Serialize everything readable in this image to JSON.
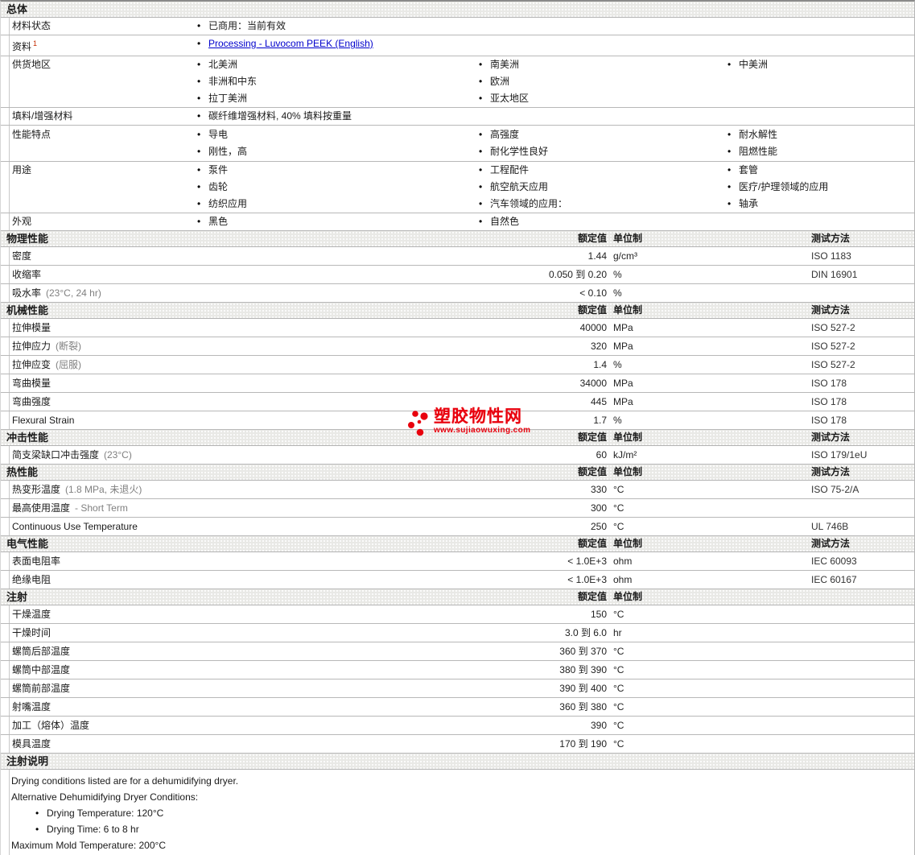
{
  "colors": {
    "accent_red": "#e8000d",
    "link_blue": "#0000cc",
    "header_bg": "#e9e9e6",
    "row_border": "#b8b8b8"
  },
  "watermark": {
    "brand": "塑胶物性网",
    "url": "www.sujiaowuxing.com"
  },
  "general": {
    "title": "总体",
    "rows": [
      {
        "label": "材料状态",
        "cols": [
          [
            "已商用：当前有效"
          ],
          [],
          []
        ]
      },
      {
        "label": "资料",
        "sup": "1",
        "link": true,
        "cols": [
          [
            "Processing - Luvocom PEEK (English)"
          ],
          [],
          []
        ]
      },
      {
        "label": "供货地区",
        "cols": [
          [
            "北美洲",
            "非洲和中东",
            "拉丁美洲"
          ],
          [
            "南美洲",
            "欧洲",
            "亚太地区"
          ],
          [
            "中美洲"
          ]
        ]
      },
      {
        "label": "填料/增强材料",
        "cols": [
          [
            "碳纤维增强材料, 40% 填料按重量"
          ],
          [],
          []
        ]
      },
      {
        "label": "性能特点",
        "pad": true,
        "cols": [
          [
            "导电",
            "刚性，高"
          ],
          [
            "高强度",
            "耐化学性良好"
          ],
          [
            "耐水解性",
            "阻燃性能"
          ]
        ]
      },
      {
        "label": "用途",
        "cols": [
          [
            "泵件",
            "齿轮",
            "纺织应用"
          ],
          [
            "工程配件",
            "航空航天应用",
            "汽车领域的应用："
          ],
          [
            "套管",
            "医疗/护理领域的应用",
            "轴承"
          ]
        ]
      },
      {
        "label": "外观",
        "cols": [
          [
            "黑色"
          ],
          [
            "自然色"
          ],
          []
        ]
      }
    ]
  },
  "col_headers": {
    "rated": "额定值",
    "unit": "单位制",
    "method": "测试方法"
  },
  "sections": [
    {
      "title": "物理性能",
      "show_method": true,
      "rows": [
        {
          "label": "密度",
          "cond": "",
          "value": "1.44",
          "unit": "g/cm³",
          "method": "ISO 1183"
        },
        {
          "label": "收缩率",
          "cond": "",
          "value": "0.050 到 0.20",
          "unit": "%",
          "method": "DIN 16901"
        },
        {
          "label": "吸水率",
          "cond": "(23°C, 24 hr)",
          "value": "< 0.10",
          "unit": "%",
          "method": ""
        }
      ]
    },
    {
      "title": "机械性能",
      "show_method": true,
      "rows": [
        {
          "label": "拉伸模量",
          "cond": "",
          "value": "40000",
          "unit": "MPa",
          "method": "ISO 527-2"
        },
        {
          "label": "拉伸应力",
          "cond": "(断裂)",
          "value": "320",
          "unit": "MPa",
          "method": "ISO 527-2"
        },
        {
          "label": "拉伸应变",
          "cond": "(屈服)",
          "value": "1.4",
          "unit": "%",
          "method": "ISO 527-2"
        },
        {
          "label": "弯曲模量",
          "cond": "",
          "value": "34000",
          "unit": "MPa",
          "method": "ISO 178"
        },
        {
          "label": "弯曲强度",
          "cond": "",
          "value": "445",
          "unit": "MPa",
          "method": "ISO 178"
        },
        {
          "label": "Flexural Strain",
          "cond": "",
          "value": "1.7",
          "unit": "%",
          "method": "ISO 178"
        }
      ]
    },
    {
      "title": "冲击性能",
      "show_method": true,
      "rows": [
        {
          "label": "简支梁缺口冲击强度",
          "cond": "(23°C)",
          "value": "60",
          "unit": "kJ/m²",
          "method": "ISO 179/1eU"
        }
      ]
    },
    {
      "title": "热性能",
      "show_method": true,
      "rows": [
        {
          "label": "热变形温度",
          "cond": "(1.8 MPa, 未退火)",
          "value": "330",
          "unit": "°C",
          "method": "ISO 75-2/A"
        },
        {
          "label": "最高使用温度",
          "cond": "- Short Term",
          "value": "300",
          "unit": "°C",
          "method": ""
        },
        {
          "label": "Continuous Use Temperature",
          "cond": "",
          "value": "250",
          "unit": "°C",
          "method": "UL 746B"
        }
      ]
    },
    {
      "title": "电气性能",
      "show_method": true,
      "rows": [
        {
          "label": "表面电阻率",
          "cond": "",
          "value": "< 1.0E+3",
          "unit": "ohm",
          "method": "IEC 60093"
        },
        {
          "label": "绝缘电阻",
          "cond": "",
          "value": "< 1.0E+3",
          "unit": "ohm",
          "method": "IEC 60167"
        }
      ]
    },
    {
      "title": "注射",
      "show_method": false,
      "rows": [
        {
          "label": "干燥温度",
          "cond": "",
          "value": "150",
          "unit": "°C",
          "method": ""
        },
        {
          "label": "干燥时间",
          "cond": "",
          "value": "3.0 到 6.0",
          "unit": "hr",
          "method": ""
        },
        {
          "label": "螺筒后部温度",
          "cond": "",
          "value": "360 到 370",
          "unit": "°C",
          "method": ""
        },
        {
          "label": "螺筒中部温度",
          "cond": "",
          "value": "380 到 390",
          "unit": "°C",
          "method": ""
        },
        {
          "label": "螺筒前部温度",
          "cond": "",
          "value": "390 到 400",
          "unit": "°C",
          "method": ""
        },
        {
          "label": "射嘴温度",
          "cond": "",
          "value": "360 到 380",
          "unit": "°C",
          "method": ""
        },
        {
          "label": "加工（熔体）温度",
          "cond": "",
          "value": "390",
          "unit": "°C",
          "method": ""
        },
        {
          "label": "模具温度",
          "cond": "",
          "value": "170 到 190",
          "unit": "°C",
          "method": ""
        }
      ]
    }
  ],
  "notes": {
    "title": "注射说明",
    "lines": [
      {
        "text": "Drying conditions listed are for a dehumidifying dryer.",
        "bullet": false
      },
      {
        "text": "Alternative Dehumidifying Dryer Conditions:",
        "bullet": false
      },
      {
        "text": "Drying Temperature: 120°C",
        "bullet": true
      },
      {
        "text": "Drying Time: 6 to 8 hr",
        "bullet": true
      },
      {
        "text": "Maximum Mold Temperature: 200°C",
        "bullet": false
      }
    ]
  }
}
